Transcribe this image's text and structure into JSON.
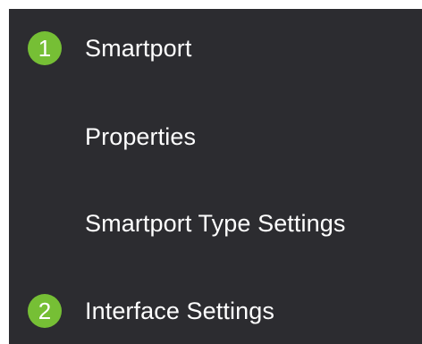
{
  "menu": {
    "items": [
      {
        "label": "Smartport",
        "badge": "1"
      },
      {
        "label": "Properties"
      },
      {
        "label": "Smartport Type Settings"
      },
      {
        "label": "Interface Settings",
        "badge": "2"
      }
    ]
  },
  "colors": {
    "background": "#2c2c30",
    "badge": "#76bf35",
    "text": "#ffffff"
  }
}
